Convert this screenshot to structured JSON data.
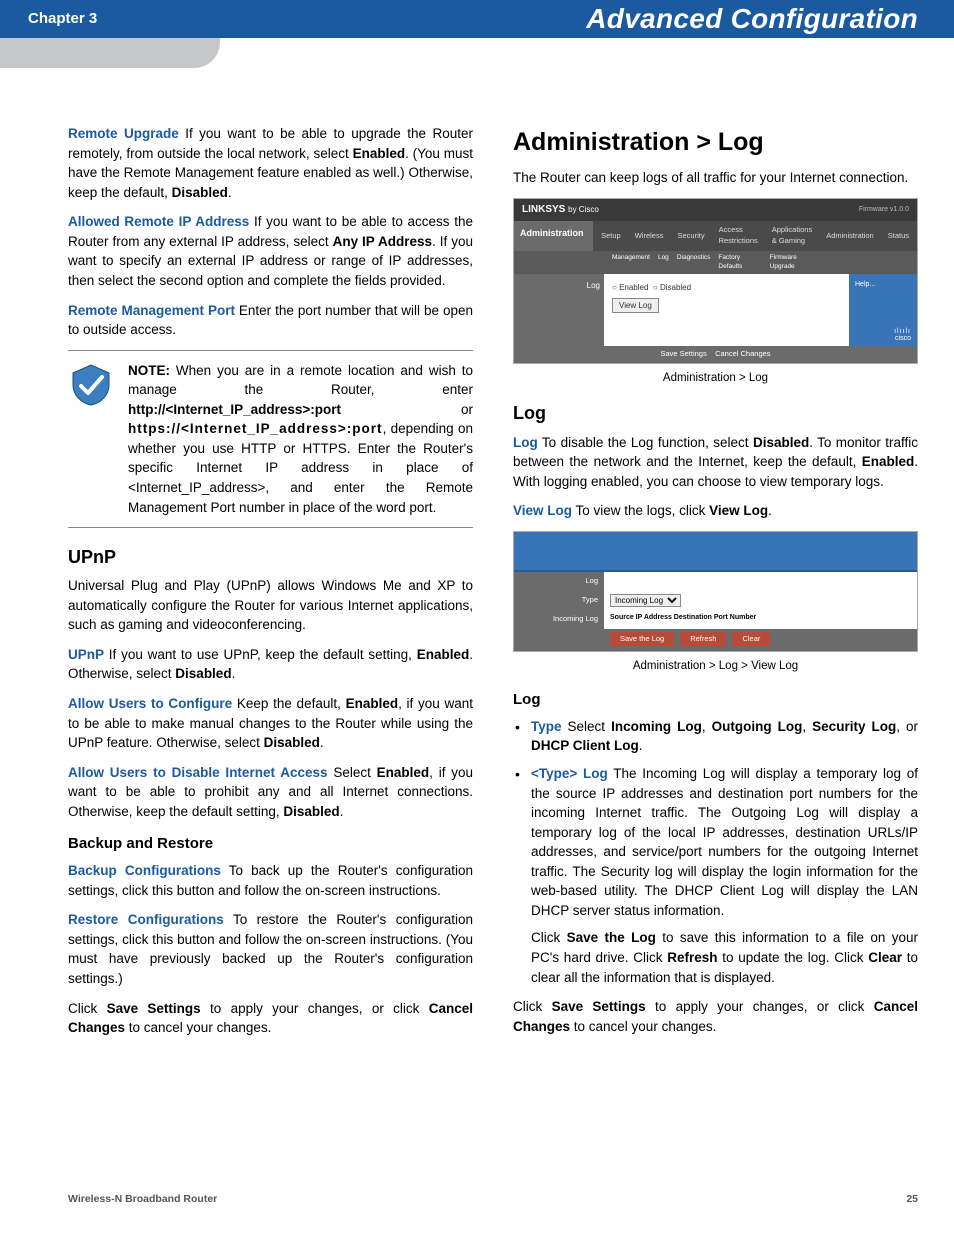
{
  "header": {
    "chapter": "Chapter 3",
    "title": "Advanced Configuration"
  },
  "left": {
    "remote_upgrade_label": "Remote Upgrade",
    "remote_upgrade_text1": "  If you want to be able to upgrade the Router remotely, from outside the local network, select ",
    "remote_upgrade_enabled": "Enabled",
    "remote_upgrade_text2": ". (You must have the Remote Management feature enabled as well.) Otherwise, keep the default, ",
    "remote_upgrade_disabled": "Disabled",
    "remote_upgrade_text3": ".",
    "allowed_ip_label": "Allowed Remote IP Address",
    "allowed_ip_text1": "  If you want to be able to access the Router from any external IP address, select ",
    "allowed_ip_any": "Any IP Address",
    "allowed_ip_text2": ". If you want to specify an external IP address or range of IP addresses, then select the second option and complete the fields provided.",
    "rmp_label": "Remote Management Port",
    "rmp_text": "  Enter the port number that will be open to outside access.",
    "note_label": "NOTE:",
    "note_text1": " When you are in a remote location and wish to manage the Router, enter ",
    "note_http": "http://<Internet_IP_address>:port",
    "note_or": " or ",
    "note_https": "https://<Internet_IP_address>:port",
    "note_text2": ", depending on whether you use HTTP or HTTPS. Enter the Router's specific Internet IP address in place of <Internet_IP_address>, and enter the Remote Management Port number in place of the word port.",
    "upnp_heading": "UPnP",
    "upnp_intro": "Universal Plug and Play (UPnP) allows Windows Me and XP to automatically configure the Router for various Internet applications, such as gaming and videoconferencing.",
    "upnp_label": "UPnP",
    "upnp_text1": "  If you want to use UPnP, keep the default setting, ",
    "upnp_enabled": "Enabled",
    "upnp_text2": ". Otherwise, select ",
    "upnp_disabled": "Disabled",
    "upnp_text3": ".",
    "allow_cfg_label": "Allow Users to Configure",
    "allow_cfg_text1": "  Keep the default, ",
    "allow_cfg_enabled": "Enabled",
    "allow_cfg_text2": ", if you want to be able to make manual changes to the Router while using the UPnP feature. Otherwise, select ",
    "allow_cfg_disabled": "Disabled",
    "allow_cfg_text3": ".",
    "allow_dis_label": "Allow Users to Disable Internet Access",
    "allow_dis_text1": "  Select ",
    "allow_dis_enabled": "Enabled",
    "allow_dis_text2": ", if you want to be able to prohibit any and all Internet connections. Otherwise, keep the default setting, ",
    "allow_dis_disabled": "Disabled",
    "allow_dis_text3": ".",
    "backup_heading": "Backup and Restore",
    "backup_label": "Backup Configurations",
    "backup_text": " To back up the Router's configuration settings, click this button and follow the on-screen instructions.",
    "restore_label": "Restore Configurations",
    "restore_text": " To restore the Router's configuration settings, click this button and follow the on-screen instructions. (You must have previously backed up the Router's configuration settings.)",
    "save_text1": "Click ",
    "save_settings": "Save Settings",
    "save_text2": " to apply your changes, or click ",
    "cancel_changes": "Cancel Changes",
    "save_text3": " to cancel your changes."
  },
  "right": {
    "section_title": "Administration > Log",
    "intro": "The Router can keep logs of all traffic for your Internet connection.",
    "ss1": {
      "brand": "LINKSYS",
      "brand_sub": "by Cisco",
      "fw": "Firmware v1.0.0",
      "side": "Administration",
      "tabs": [
        "Setup",
        "Wireless",
        "Security",
        "Access Restrictions",
        "Applications & Gaming",
        "Administration",
        "Status"
      ],
      "subtabs": [
        "Management",
        "Log",
        "Diagnostics",
        "Factory Defaults",
        "Firmware Upgrade"
      ],
      "left_label": "Log",
      "enabled": "Enabled",
      "disabled": "Disabled",
      "viewlog_btn": "View Log",
      "help": "Help...",
      "footer_save": "Save Settings",
      "footer_cancel": "Cancel Changes",
      "cisco": "cisco"
    },
    "caption1": "Administration > Log",
    "log_heading": "Log",
    "log_label": "Log",
    "log_text1": "  To disable the Log function, select ",
    "log_disabled": "Disabled",
    "log_text2": ". To monitor traffic between the network and the Internet, keep the default, ",
    "log_enabled": "Enabled",
    "log_text3": ". With logging enabled, you can choose to view temporary logs.",
    "viewlog_label": "View Log",
    "viewlog_text1": "  To view the logs, click ",
    "viewlog_bold": "View Log",
    "viewlog_text2": ".",
    "ss2": {
      "row1_label": "Log",
      "row2_label": "Type",
      "row2_value": "Incoming Log",
      "row3_label": "Incoming Log",
      "row3_value": "Source IP Address Destination Port Number",
      "btn_save": "Save the Log",
      "btn_refresh": "Refresh",
      "btn_clear": "Clear"
    },
    "caption2": "Administration > Log > View Log",
    "log_sub_heading": "Log",
    "bullet_type_label": "Type",
    "bullet_type_text1": "  Select ",
    "bullet_type_in": "Incoming Log",
    "bullet_type_c1": ", ",
    "bullet_type_out": "Outgoing Log",
    "bullet_type_c2": ", ",
    "bullet_type_sec": "Security Log",
    "bullet_type_c3": ", or ",
    "bullet_type_dhcp": "DHCP Client Log",
    "bullet_type_c4": ".",
    "bullet_typelog_label": "<Type> Log",
    "bullet_typelog_text": " The Incoming Log will display a temporary log of the source IP addresses and destination port numbers for the incoming Internet traffic. The Outgoing Log will display a temporary log of the local IP addresses, destination URLs/IP addresses, and service/port numbers for the outgoing Internet traffic. The Security log will display the login information for the web-based utility. The DHCP Client Log will display the LAN DHCP server status information.",
    "bullet_typelog_p2_1": "Click ",
    "bullet_typelog_p2_save": "Save the Log",
    "bullet_typelog_p2_2": " to save this information to a file on your PC's hard drive. Click ",
    "bullet_typelog_p2_refresh": "Refresh",
    "bullet_typelog_p2_3": " to update the log. Click ",
    "bullet_typelog_p2_clear": "Clear",
    "bullet_typelog_p2_4": " to clear all the information that is displayed.",
    "save_text1": "Click ",
    "save_settings": "Save Settings",
    "save_text2": " to apply your changes, or click ",
    "cancel_changes": "Cancel Changes",
    "save_text3": " to cancel your changes."
  },
  "footer": {
    "product": "Wireless-N Broadband Router",
    "page": "25"
  }
}
